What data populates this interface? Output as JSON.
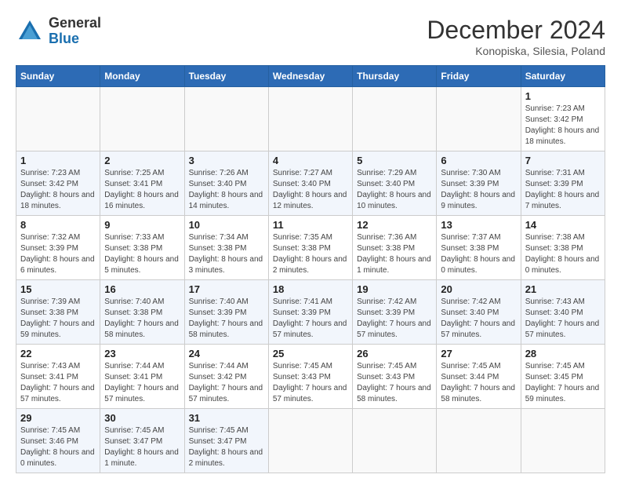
{
  "header": {
    "logo_general": "General",
    "logo_blue": "Blue",
    "month_title": "December 2024",
    "subtitle": "Konopiska, Silesia, Poland"
  },
  "calendar": {
    "days_of_week": [
      "Sunday",
      "Monday",
      "Tuesday",
      "Wednesday",
      "Thursday",
      "Friday",
      "Saturday"
    ],
    "weeks": [
      [
        null,
        null,
        null,
        null,
        null,
        null,
        {
          "day": 1,
          "sunrise": "7:23 AM",
          "sunset": "3:42 PM",
          "daylight": "8 hours and 18 minutes."
        }
      ],
      [
        {
          "day": 1,
          "sunrise": "7:23 AM",
          "sunset": "3:42 PM",
          "daylight": "8 hours and 18 minutes."
        },
        {
          "day": 2,
          "sunrise": "7:25 AM",
          "sunset": "3:41 PM",
          "daylight": "8 hours and 16 minutes."
        },
        {
          "day": 3,
          "sunrise": "7:26 AM",
          "sunset": "3:40 PM",
          "daylight": "8 hours and 14 minutes."
        },
        {
          "day": 4,
          "sunrise": "7:27 AM",
          "sunset": "3:40 PM",
          "daylight": "8 hours and 12 minutes."
        },
        {
          "day": 5,
          "sunrise": "7:29 AM",
          "sunset": "3:40 PM",
          "daylight": "8 hours and 10 minutes."
        },
        {
          "day": 6,
          "sunrise": "7:30 AM",
          "sunset": "3:39 PM",
          "daylight": "8 hours and 9 minutes."
        },
        {
          "day": 7,
          "sunrise": "7:31 AM",
          "sunset": "3:39 PM",
          "daylight": "8 hours and 7 minutes."
        }
      ],
      [
        {
          "day": 8,
          "sunrise": "7:32 AM",
          "sunset": "3:39 PM",
          "daylight": "8 hours and 6 minutes."
        },
        {
          "day": 9,
          "sunrise": "7:33 AM",
          "sunset": "3:38 PM",
          "daylight": "8 hours and 5 minutes."
        },
        {
          "day": 10,
          "sunrise": "7:34 AM",
          "sunset": "3:38 PM",
          "daylight": "8 hours and 3 minutes."
        },
        {
          "day": 11,
          "sunrise": "7:35 AM",
          "sunset": "3:38 PM",
          "daylight": "8 hours and 2 minutes."
        },
        {
          "day": 12,
          "sunrise": "7:36 AM",
          "sunset": "3:38 PM",
          "daylight": "8 hours and 1 minute."
        },
        {
          "day": 13,
          "sunrise": "7:37 AM",
          "sunset": "3:38 PM",
          "daylight": "8 hours and 0 minutes."
        },
        {
          "day": 14,
          "sunrise": "7:38 AM",
          "sunset": "3:38 PM",
          "daylight": "8 hours and 0 minutes."
        }
      ],
      [
        {
          "day": 15,
          "sunrise": "7:39 AM",
          "sunset": "3:38 PM",
          "daylight": "7 hours and 59 minutes."
        },
        {
          "day": 16,
          "sunrise": "7:40 AM",
          "sunset": "3:38 PM",
          "daylight": "7 hours and 58 minutes."
        },
        {
          "day": 17,
          "sunrise": "7:40 AM",
          "sunset": "3:39 PM",
          "daylight": "7 hours and 58 minutes."
        },
        {
          "day": 18,
          "sunrise": "7:41 AM",
          "sunset": "3:39 PM",
          "daylight": "7 hours and 57 minutes."
        },
        {
          "day": 19,
          "sunrise": "7:42 AM",
          "sunset": "3:39 PM",
          "daylight": "7 hours and 57 minutes."
        },
        {
          "day": 20,
          "sunrise": "7:42 AM",
          "sunset": "3:40 PM",
          "daylight": "7 hours and 57 minutes."
        },
        {
          "day": 21,
          "sunrise": "7:43 AM",
          "sunset": "3:40 PM",
          "daylight": "7 hours and 57 minutes."
        }
      ],
      [
        {
          "day": 22,
          "sunrise": "7:43 AM",
          "sunset": "3:41 PM",
          "daylight": "7 hours and 57 minutes."
        },
        {
          "day": 23,
          "sunrise": "7:44 AM",
          "sunset": "3:41 PM",
          "daylight": "7 hours and 57 minutes."
        },
        {
          "day": 24,
          "sunrise": "7:44 AM",
          "sunset": "3:42 PM",
          "daylight": "7 hours and 57 minutes."
        },
        {
          "day": 25,
          "sunrise": "7:45 AM",
          "sunset": "3:43 PM",
          "daylight": "7 hours and 57 minutes."
        },
        {
          "day": 26,
          "sunrise": "7:45 AM",
          "sunset": "3:43 PM",
          "daylight": "7 hours and 58 minutes."
        },
        {
          "day": 27,
          "sunrise": "7:45 AM",
          "sunset": "3:44 PM",
          "daylight": "7 hours and 58 minutes."
        },
        {
          "day": 28,
          "sunrise": "7:45 AM",
          "sunset": "3:45 PM",
          "daylight": "7 hours and 59 minutes."
        }
      ],
      [
        {
          "day": 29,
          "sunrise": "7:45 AM",
          "sunset": "3:46 PM",
          "daylight": "8 hours and 0 minutes."
        },
        {
          "day": 30,
          "sunrise": "7:45 AM",
          "sunset": "3:47 PM",
          "daylight": "8 hours and 1 minute."
        },
        {
          "day": 31,
          "sunrise": "7:45 AM",
          "sunset": "3:47 PM",
          "daylight": "8 hours and 2 minutes."
        },
        null,
        null,
        null,
        null
      ]
    ]
  }
}
